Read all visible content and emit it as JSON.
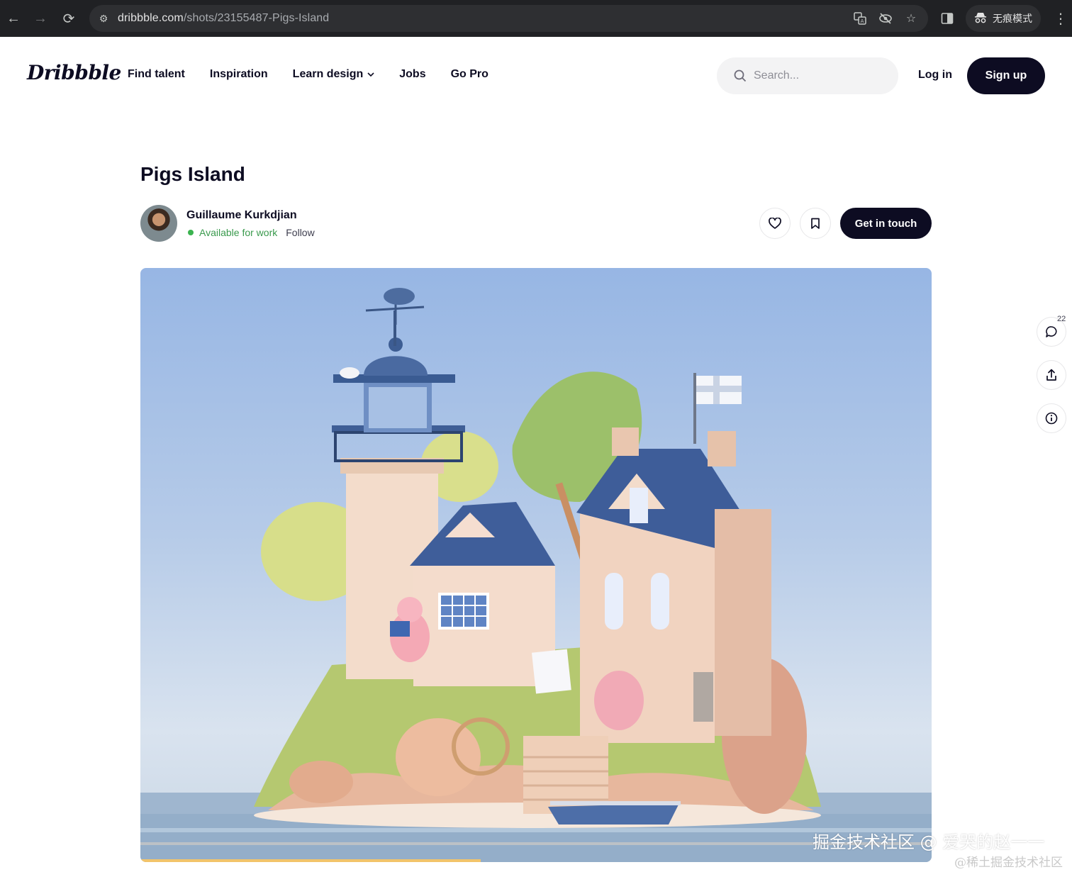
{
  "browser": {
    "url_domain": "dribbble.com",
    "url_path": "/shots/23155487-Pigs-Island",
    "incognito_label": "无痕模式",
    "icons": [
      "back-icon",
      "forward-icon",
      "reload-icon",
      "site-info-icon",
      "translate-icon",
      "eye-off-icon",
      "star-icon",
      "side-panel-icon",
      "incognito-icon",
      "kebab-icon"
    ]
  },
  "header": {
    "logo": "Dribbble",
    "nav": [
      {
        "label": "Find talent"
      },
      {
        "label": "Inspiration"
      },
      {
        "label": "Learn design"
      },
      {
        "label": "Jobs"
      },
      {
        "label": "Go Pro"
      }
    ],
    "search_placeholder": "Search...",
    "login": "Log in",
    "signup": "Sign up"
  },
  "shot": {
    "title": "Pigs Island",
    "author": "Guillaume Kurkdjian",
    "availability": "Available for work",
    "follow": "Follow",
    "get_in_touch": "Get in touch",
    "comment_count": "22",
    "progress_fraction": 0.43
  },
  "colors": {
    "brand_dark": "#0d0c22",
    "available_green": "#3bb34f",
    "progress": "#f2c46b"
  },
  "watermark": {
    "line1": "掘金技术社区 @ 爱哭的赵一一",
    "line2": "@稀土掘金技术社区"
  }
}
